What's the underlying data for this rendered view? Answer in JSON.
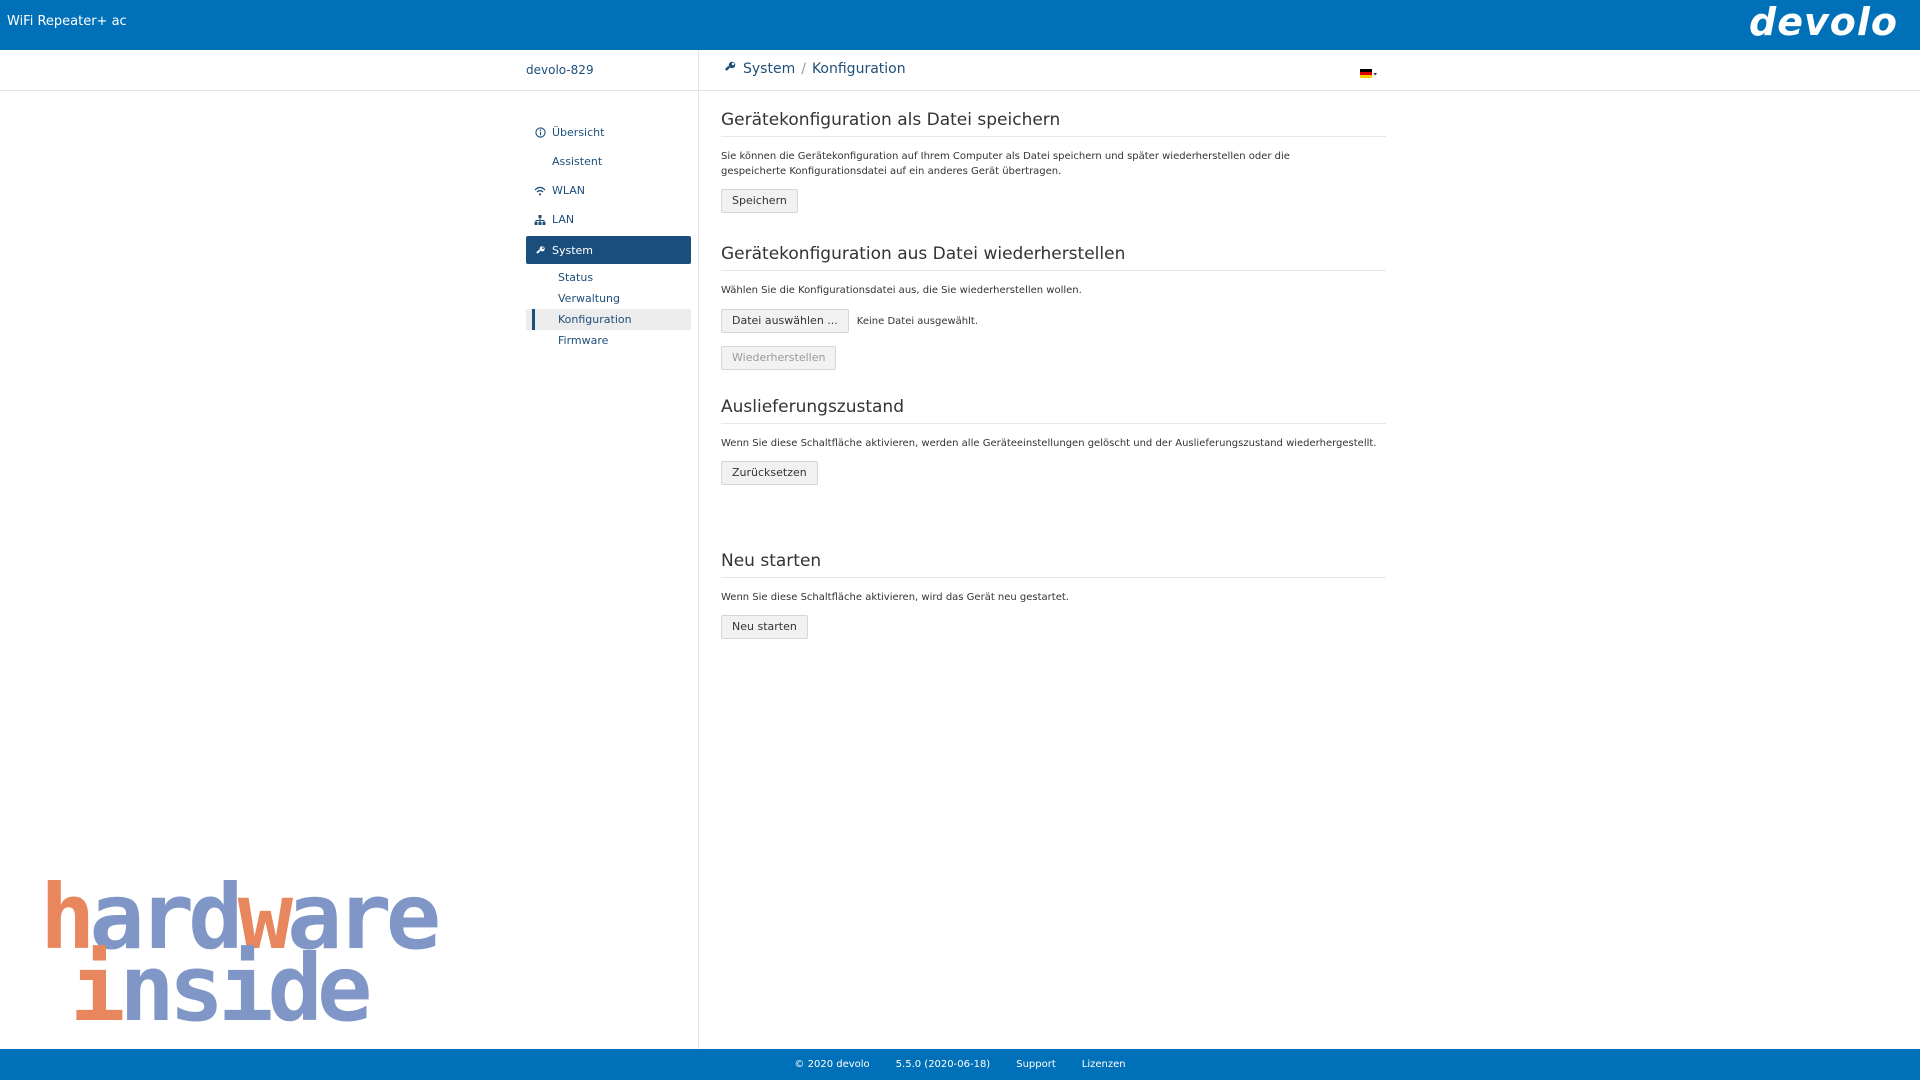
{
  "header": {
    "app_title": "WiFi Repeater+ ac",
    "logo": "devolo"
  },
  "subbar": {
    "device_name": "devolo-829",
    "breadcrumb": [
      "System",
      "Konfiguration"
    ],
    "breadcrumb_icon": "wrench-icon",
    "language_flag": "de-flag"
  },
  "sidebar": {
    "items": [
      {
        "label": "Übersicht",
        "icon": "info-icon"
      },
      {
        "label": "Assistent",
        "icon": ""
      },
      {
        "label": "WLAN",
        "icon": "wifi-icon"
      },
      {
        "label": "LAN",
        "icon": "network-icon"
      },
      {
        "label": "System",
        "icon": "wrench-icon",
        "active": true
      }
    ],
    "subitems": [
      {
        "label": "Status"
      },
      {
        "label": "Verwaltung"
      },
      {
        "label": "Konfiguration",
        "current": true
      },
      {
        "label": "Firmware"
      }
    ]
  },
  "main": {
    "save": {
      "title": "Gerätekonfiguration als Datei speichern",
      "text": "Sie können die Gerätekonfiguration auf Ihrem Computer als Datei speichern und später wiederherstellen oder die gespeicherte Konfigurationsdatei auf ein anderes Gerät übertragen.",
      "button": "Speichern"
    },
    "restore": {
      "title": "Gerätekonfiguration aus Datei wiederherstellen",
      "text": "Wählen Sie die Konfigurationsdatei aus, die Sie wiederherstellen wollen.",
      "file_button": "Datei auswählen ...",
      "file_status": "Keine Datei ausgewählt.",
      "button": "Wiederherstellen"
    },
    "reset": {
      "title": "Auslieferungszustand",
      "text": "Wenn Sie diese Schaltfläche aktivieren, werden alle Geräteeinstellungen gelöscht und der Auslieferungszustand wiederhergestellt.",
      "button": "Zurücksetzen"
    },
    "reboot": {
      "title": "Neu starten",
      "text": "Wenn Sie diese Schaltfläche aktivieren, wird das Gerät neu gestartet.",
      "button": "Neu starten"
    }
  },
  "footer": {
    "copyright": "© 2020   devolo",
    "version": "5.5.0 (2020-06-18)",
    "support": "Support",
    "licenses": "Lizenzen"
  },
  "watermark": {
    "line1": "hardware",
    "line2": "inside"
  },
  "colors": {
    "brand": "#0071b8",
    "nav_active": "#1a4e7d",
    "watermark_orange": "#e8875e",
    "watermark_blue": "#7f96c6"
  }
}
